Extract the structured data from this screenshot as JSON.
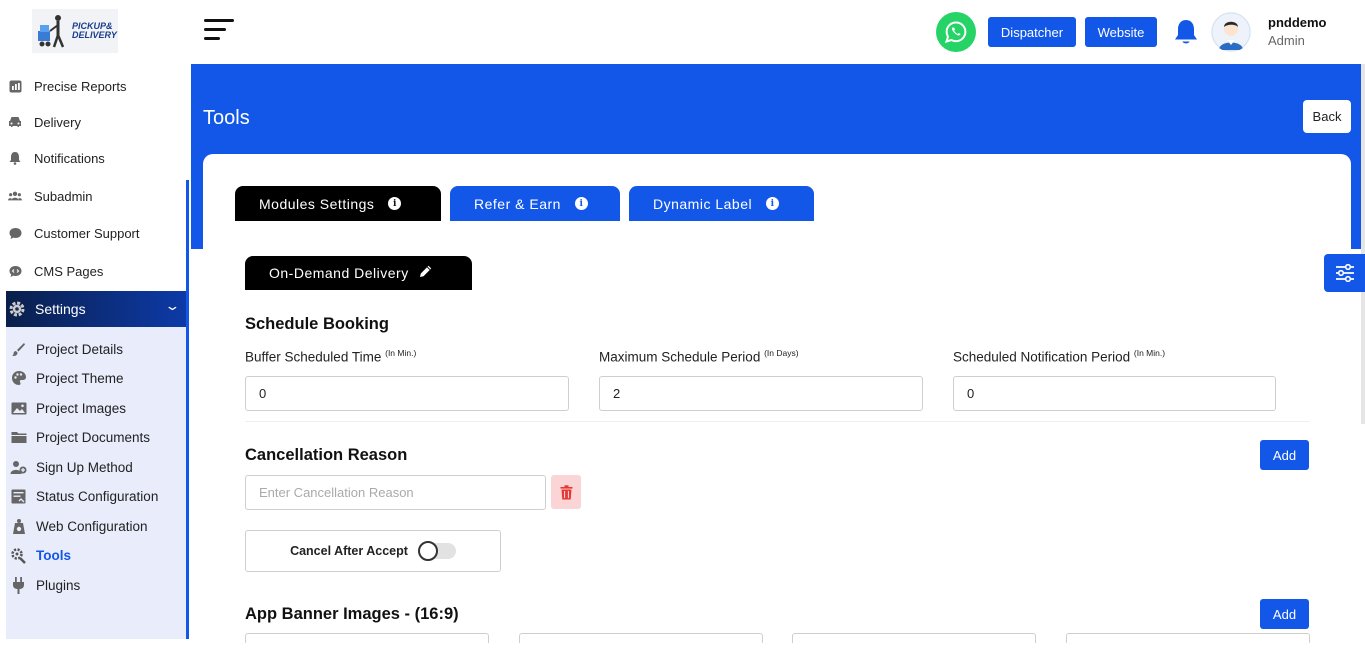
{
  "logo": {
    "line1": "PICKUP&",
    "line2": "DELIVERY"
  },
  "sidebar": {
    "items": [
      {
        "label": "Precise Reports",
        "icon": "reports-icon"
      },
      {
        "label": "Delivery",
        "icon": "car-icon"
      },
      {
        "label": "Notifications",
        "icon": "bell-icon"
      },
      {
        "label": "Subadmin",
        "icon": "users-icon"
      },
      {
        "label": "Customer Support",
        "icon": "chat-icon"
      },
      {
        "label": "CMS Pages",
        "icon": "code-chat-icon"
      }
    ],
    "settings": {
      "label": "Settings",
      "icon": "gear-icon"
    },
    "submenu": [
      {
        "label": "Project Details",
        "icon": "brush-icon"
      },
      {
        "label": "Project Theme",
        "icon": "palette-icon"
      },
      {
        "label": "Project Images",
        "icon": "image-icon"
      },
      {
        "label": "Project Documents",
        "icon": "folder-icon"
      },
      {
        "label": "Sign Up Method",
        "icon": "user-plus-icon"
      },
      {
        "label": "Status Configuration",
        "icon": "status-icon"
      },
      {
        "label": "Web Configuration",
        "icon": "web-config-icon"
      },
      {
        "label": "Tools",
        "icon": "tools-icon",
        "active": true
      },
      {
        "label": "Plugins",
        "icon": "plug-icon"
      }
    ]
  },
  "header": {
    "dispatcher_label": "Dispatcher",
    "website_label": "Website",
    "user_name": "pnddemo",
    "user_role": "Admin"
  },
  "page": {
    "title": "Tools",
    "back_label": "Back"
  },
  "tabs": [
    {
      "label": "Modules Settings",
      "active": true
    },
    {
      "label": "Refer & Earn",
      "active": false
    },
    {
      "label": "Dynamic Label",
      "active": false
    }
  ],
  "subtab": {
    "label": "On-Demand Delivery"
  },
  "schedule": {
    "title": "Schedule Booking",
    "fields": [
      {
        "label": "Buffer Scheduled Time",
        "unit": "(In Min.)",
        "value": "0"
      },
      {
        "label": "Maximum Schedule Period",
        "unit": "(In Days)",
        "value": "2"
      },
      {
        "label": "Scheduled Notification Period",
        "unit": "(In Min.)",
        "value": "0"
      }
    ]
  },
  "cancellation": {
    "title": "Cancellation Reason",
    "add_label": "Add",
    "placeholder": "Enter Cancellation Reason",
    "cancel_after_accept_label": "Cancel After Accept",
    "cancel_after_accept_on": false
  },
  "banners": {
    "title": "App Banner Images - (16:9)",
    "add_label": "Add"
  },
  "colors": {
    "primary": "#1257e8",
    "sidebar_active_from": "#0a1f4a",
    "submenu_bg": "#e8ecfb",
    "whatsapp": "#25d366",
    "delete_bg": "#fbd5d5",
    "delete_icon": "#e53935"
  }
}
